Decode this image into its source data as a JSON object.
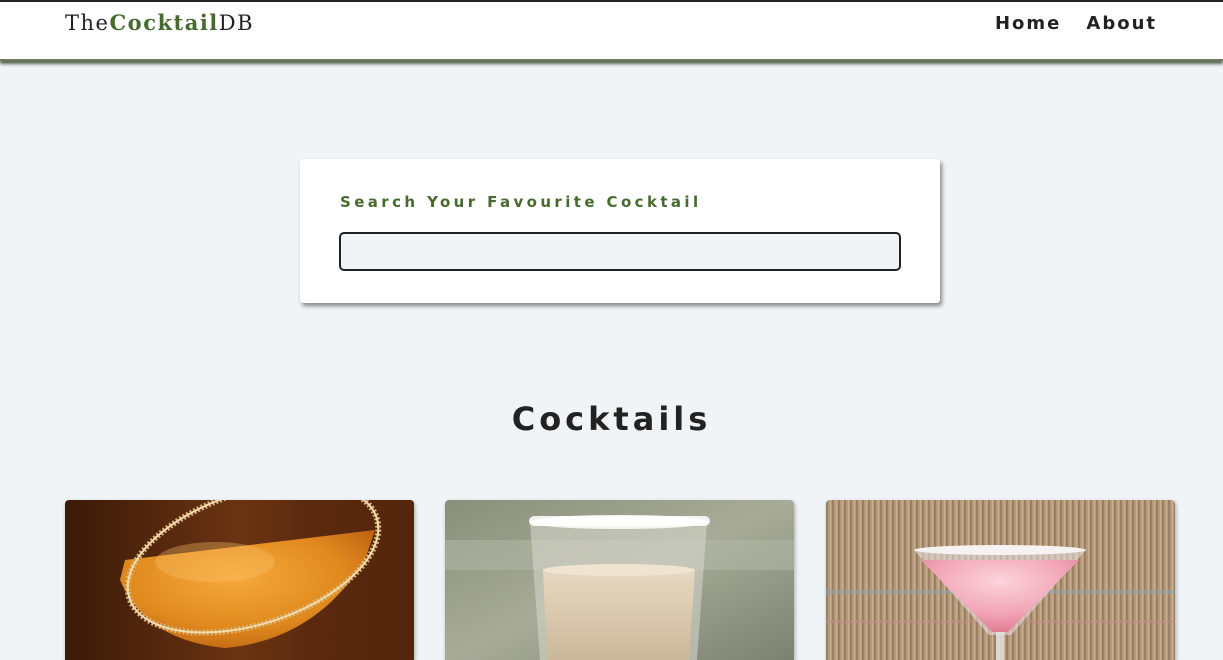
{
  "nav": {
    "logo": {
      "prefix": "The",
      "accent": "Cocktail",
      "suffix": "DB"
    },
    "links": [
      {
        "label": "Home"
      },
      {
        "label": "About"
      }
    ]
  },
  "search": {
    "label": "Search Your Favourite Cocktail",
    "value": "",
    "placeholder": ""
  },
  "section": {
    "title": "Cocktails"
  },
  "colors": {
    "accent": "#476a2e",
    "background": "#f0f4f7",
    "text": "#222222"
  },
  "cocktails": [
    {
      "image": "orange cocktail with sugared rim in martini glass"
    },
    {
      "image": "creamy cocktail in salt-rimmed short glass"
    },
    {
      "image": "pink cocktail in martini glass"
    }
  ]
}
